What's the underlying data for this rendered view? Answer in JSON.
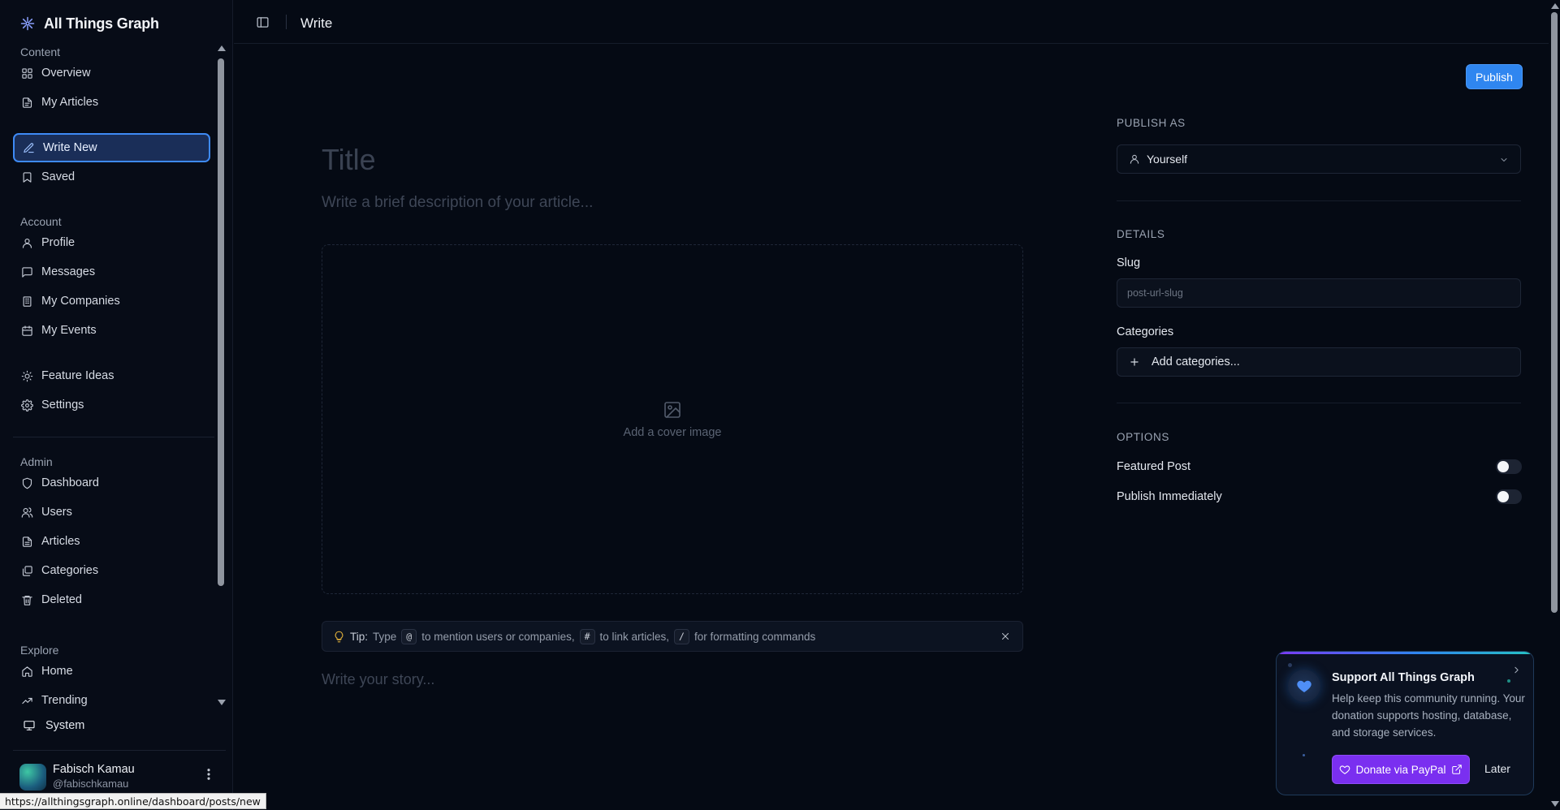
{
  "app": {
    "brand_name": "All Things Graph",
    "accent_color": "#2f86f0",
    "donate_color": "#7a2ff0"
  },
  "header": {
    "title": "Write",
    "toggle_icon": "sidebar-toggle-icon"
  },
  "sidebar": {
    "sections": [
      {
        "label": "Content",
        "items": [
          {
            "label": "Overview",
            "icon": "grid-icon"
          },
          {
            "label": "My Articles",
            "icon": "file-text-icon"
          },
          {
            "label": "Write New",
            "icon": "pen-icon",
            "active": true
          },
          {
            "label": "Saved",
            "icon": "bookmark-icon"
          }
        ]
      },
      {
        "label": "Account",
        "items": [
          {
            "label": "Profile",
            "icon": "user-icon"
          },
          {
            "label": "Messages",
            "icon": "message-icon"
          },
          {
            "label": "My Companies",
            "icon": "building-icon"
          },
          {
            "label": "My Events",
            "icon": "calendar-icon"
          }
        ]
      },
      {
        "label": "",
        "items": [
          {
            "label": "Feature Ideas",
            "icon": "lightbulb-icon"
          },
          {
            "label": "Settings",
            "icon": "gear-icon"
          }
        ]
      },
      {
        "label": "Admin",
        "items": [
          {
            "label": "Dashboard",
            "icon": "shield-icon"
          },
          {
            "label": "Users",
            "icon": "users-icon"
          },
          {
            "label": "Articles",
            "icon": "file-icon"
          },
          {
            "label": "Categories",
            "icon": "layers-icon"
          },
          {
            "label": "Deleted",
            "icon": "trash-icon"
          }
        ]
      },
      {
        "label": "Explore",
        "items": [
          {
            "label": "Home",
            "icon": "home-icon"
          },
          {
            "label": "Trending",
            "icon": "trending-icon"
          }
        ]
      }
    ],
    "system_label": "System",
    "user": {
      "name": "Fabisch Kamau",
      "handle": "@fabischkamau"
    }
  },
  "status_bar": {
    "url": "https://allthingsgraph.online/dashboard/posts/new"
  },
  "editor": {
    "publish_label": "Publish",
    "title_placeholder": "Title",
    "description_placeholder": "Write a brief description of your article...",
    "cover_label": "Add a cover image",
    "tip": {
      "strong": "Tip:",
      "part1": "Type",
      "key1": "@",
      "part2": "to mention users or companies,",
      "key2": "#",
      "part3": "to link articles,",
      "key3": "/",
      "part4": "for formatting commands"
    },
    "story_placeholder": "Write your story..."
  },
  "panel": {
    "publish_as_heading": "PUBLISH AS",
    "publish_as_value": "Yourself",
    "details_heading": "DETAILS",
    "slug_label": "Slug",
    "slug_placeholder": "post-url-slug",
    "categories_label": "Categories",
    "add_categories_label": "Add categories...",
    "options_heading": "OPTIONS",
    "featured_label": "Featured Post",
    "featured_on": false,
    "immediately_label": "Publish Immediately",
    "immediately_on": false
  },
  "donate": {
    "title": "Support All Things Graph",
    "text": "Help keep this community running. Your donation supports hosting, database, and storage services.",
    "button_label": "Donate via PayPal",
    "later_label": "Later"
  }
}
